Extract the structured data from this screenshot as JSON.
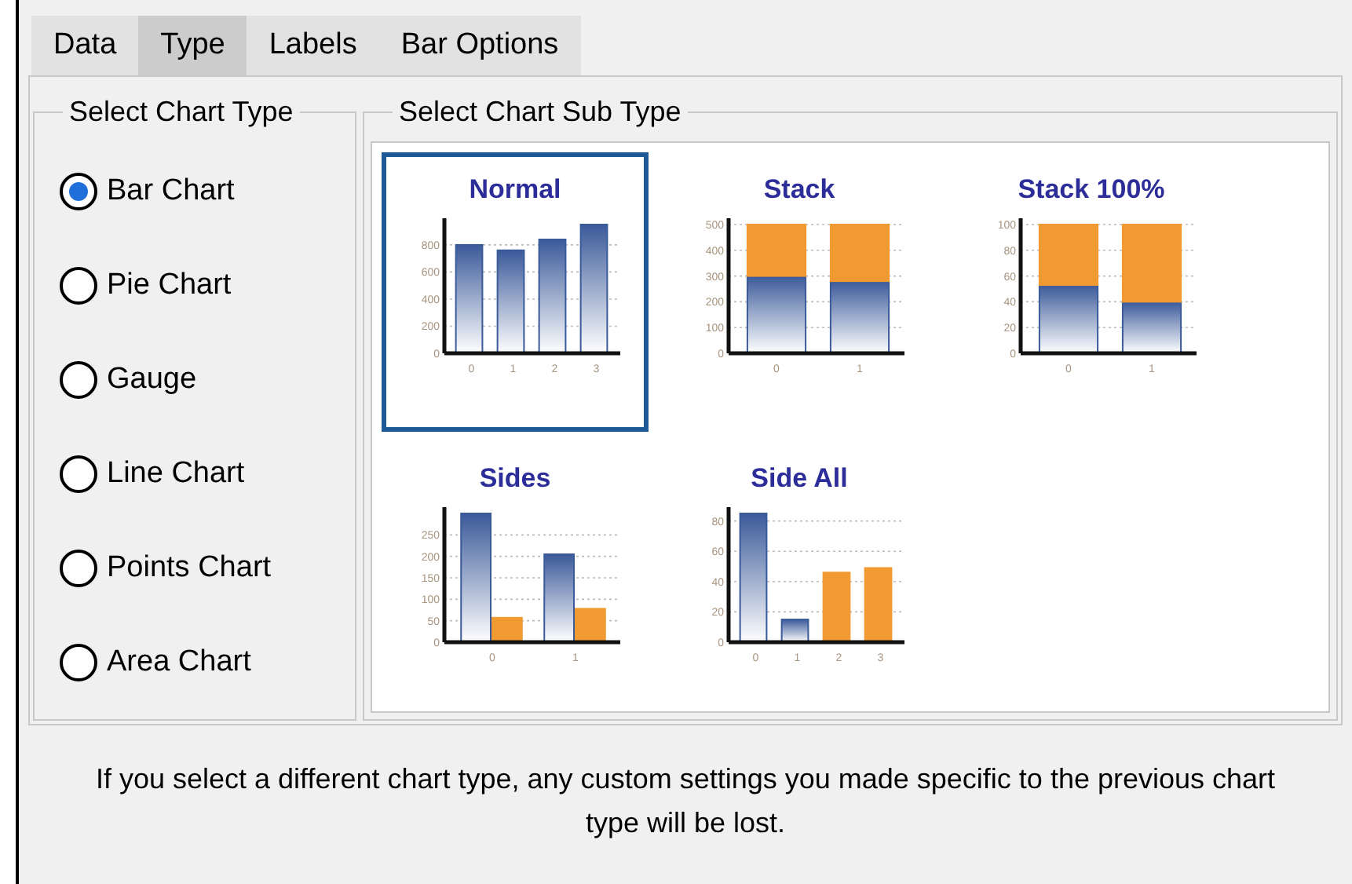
{
  "tabs": [
    {
      "label": "Data",
      "selected": false
    },
    {
      "label": "Type",
      "selected": true
    },
    {
      "label": "Labels",
      "selected": false
    },
    {
      "label": "Bar Options",
      "selected": false
    }
  ],
  "chart_type_group": {
    "title": "Select Chart Type",
    "options": [
      {
        "label": "Bar Chart",
        "selected": true
      },
      {
        "label": "Pie Chart",
        "selected": false
      },
      {
        "label": "Gauge",
        "selected": false
      },
      {
        "label": "Line Chart",
        "selected": false
      },
      {
        "label": "Points Chart",
        "selected": false
      },
      {
        "label": "Area Chart",
        "selected": false
      }
    ]
  },
  "sub_type_group": {
    "title": "Select Chart Sub Type",
    "options": [
      {
        "selected": true,
        "chart_data": {
          "type": "bar",
          "title": "Normal",
          "categories": [
            "0",
            "1",
            "2",
            "3"
          ],
          "grid": true,
          "series": [
            {
              "color": "#3b5a9a",
              "values": [
                800,
                760,
                840,
                950
              ]
            }
          ],
          "ylim": [
            0,
            950
          ],
          "yticks": [
            0,
            200,
            400,
            600,
            800
          ],
          "stacked": false
        }
      },
      {
        "selected": false,
        "chart_data": {
          "type": "bar",
          "title": "Stack",
          "categories": [
            "0",
            "1"
          ],
          "grid": true,
          "series": [
            {
              "color": "#3b5a9a",
              "values": [
                300,
                280
              ]
            },
            {
              "color": "#f29a32",
              "values": [
                200,
                220
              ]
            }
          ],
          "ylim": [
            0,
            500
          ],
          "yticks": [
            0,
            100,
            200,
            300,
            400,
            500
          ],
          "stacked": true
        }
      },
      {
        "selected": false,
        "chart_data": {
          "type": "bar",
          "title": "Stack 100%",
          "categories": [
            "0",
            "1"
          ],
          "grid": true,
          "series": [
            {
              "color": "#3b5a9a",
              "values": [
                53,
                40
              ]
            },
            {
              "color": "#f29a32",
              "values": [
                47,
                60
              ]
            }
          ],
          "ylim": [
            0,
            100
          ],
          "yticks": [
            0,
            20,
            40,
            60,
            80,
            100
          ],
          "stacked": true
        }
      },
      {
        "selected": false,
        "chart_data": {
          "type": "bar",
          "title": "Sides",
          "categories": [
            "0",
            "1"
          ],
          "grid": true,
          "series": [
            {
              "color": "#3b5a9a",
              "values": [
                300,
                205
              ]
            },
            {
              "color": "#f29a32",
              "values": [
                57,
                78
              ]
            }
          ],
          "ylim": [
            0,
            300
          ],
          "yticks": [
            0,
            50,
            100,
            150,
            200,
            250
          ],
          "stacked": false
        }
      },
      {
        "selected": false,
        "chart_data": {
          "type": "bar",
          "title": "Side All",
          "categories": [
            "0",
            "1",
            "2",
            "3"
          ],
          "grid": true,
          "series": [
            {
              "color": "#3b5a9a",
              "values": [
                85,
                15,
                null,
                null
              ]
            },
            {
              "color": "#f29a32",
              "values": [
                null,
                null,
                46,
                49
              ]
            }
          ],
          "ylim": [
            0,
            85
          ],
          "yticks": [
            0,
            20,
            40,
            60,
            80
          ],
          "stacked": false
        }
      }
    ]
  },
  "note": "If you select a different chart type, any custom settings you made specific to the previous chart type will be lost."
}
